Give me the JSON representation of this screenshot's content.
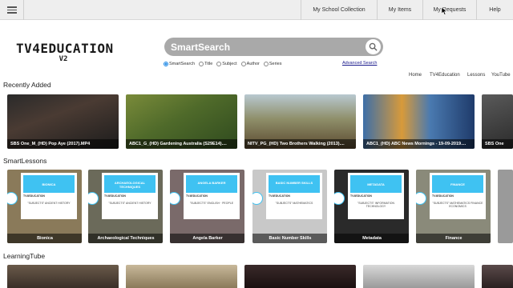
{
  "topbar": {
    "menu_icon": "hamburger-icon",
    "nav": [
      "My School Collection",
      "My Items",
      "My Requests",
      "Help"
    ]
  },
  "logo": {
    "line1": "TV4EDUCATION",
    "line2": "V2"
  },
  "search": {
    "placeholder": "SmartSearch",
    "icon": "search-icon",
    "options": [
      "SmartSearch",
      "Title",
      "Subject",
      "Author",
      "Series"
    ],
    "selected": "SmartSearch",
    "advanced": "Advanced Search"
  },
  "subnav": [
    "Home",
    "TV4Education",
    "Lessons",
    "YouTube"
  ],
  "sections": {
    "recent": {
      "title": "Recently Added",
      "items": [
        "SBS One_M_(HD) Pop Aye (2017).MP4",
        "ABC1_G_(HD) Gardening Australia (S29E14)....",
        "NITV_PG_(HD) Two Brothers Walking (2013)....",
        "ABC1_(HD) ABC News Mornings - 19-09-2019....",
        "SBS One"
      ]
    },
    "smart": {
      "title": "SmartLessons",
      "items": [
        {
          "banner": "BIONICA",
          "sub": "\"SUBJECTS\" ANCIENT HISTORY",
          "caption": "Bionica"
        },
        {
          "banner": "ARCHAEOLOGICAL TECHNIQUES",
          "sub": "\"SUBJECTS\" ANCIENT HISTORY",
          "caption": "Archaeological Techniques"
        },
        {
          "banner": "ANGELA BARKER",
          "sub": "\"SUBJECTS\" ENGLISH · PEOPLE",
          "caption": "Angela Barker"
        },
        {
          "banner": "BASIC NUMBER SKILLS",
          "sub": "\"SUBJECTS\" MATHEMATICS",
          "caption": "Basic Number Skills"
        },
        {
          "banner": "METADATA",
          "sub": "\"SUBJECTS\" INFORMATION TECHNOLOGY",
          "caption": "Metadata"
        },
        {
          "banner": "FINANCE",
          "sub": "\"SUBJECTS\" MATHEMATICS FINANCE ECONOMICS",
          "caption": "Finance"
        }
      ],
      "brand": "TV4EDUCATION"
    },
    "learning": {
      "title": "LearningTube"
    }
  }
}
